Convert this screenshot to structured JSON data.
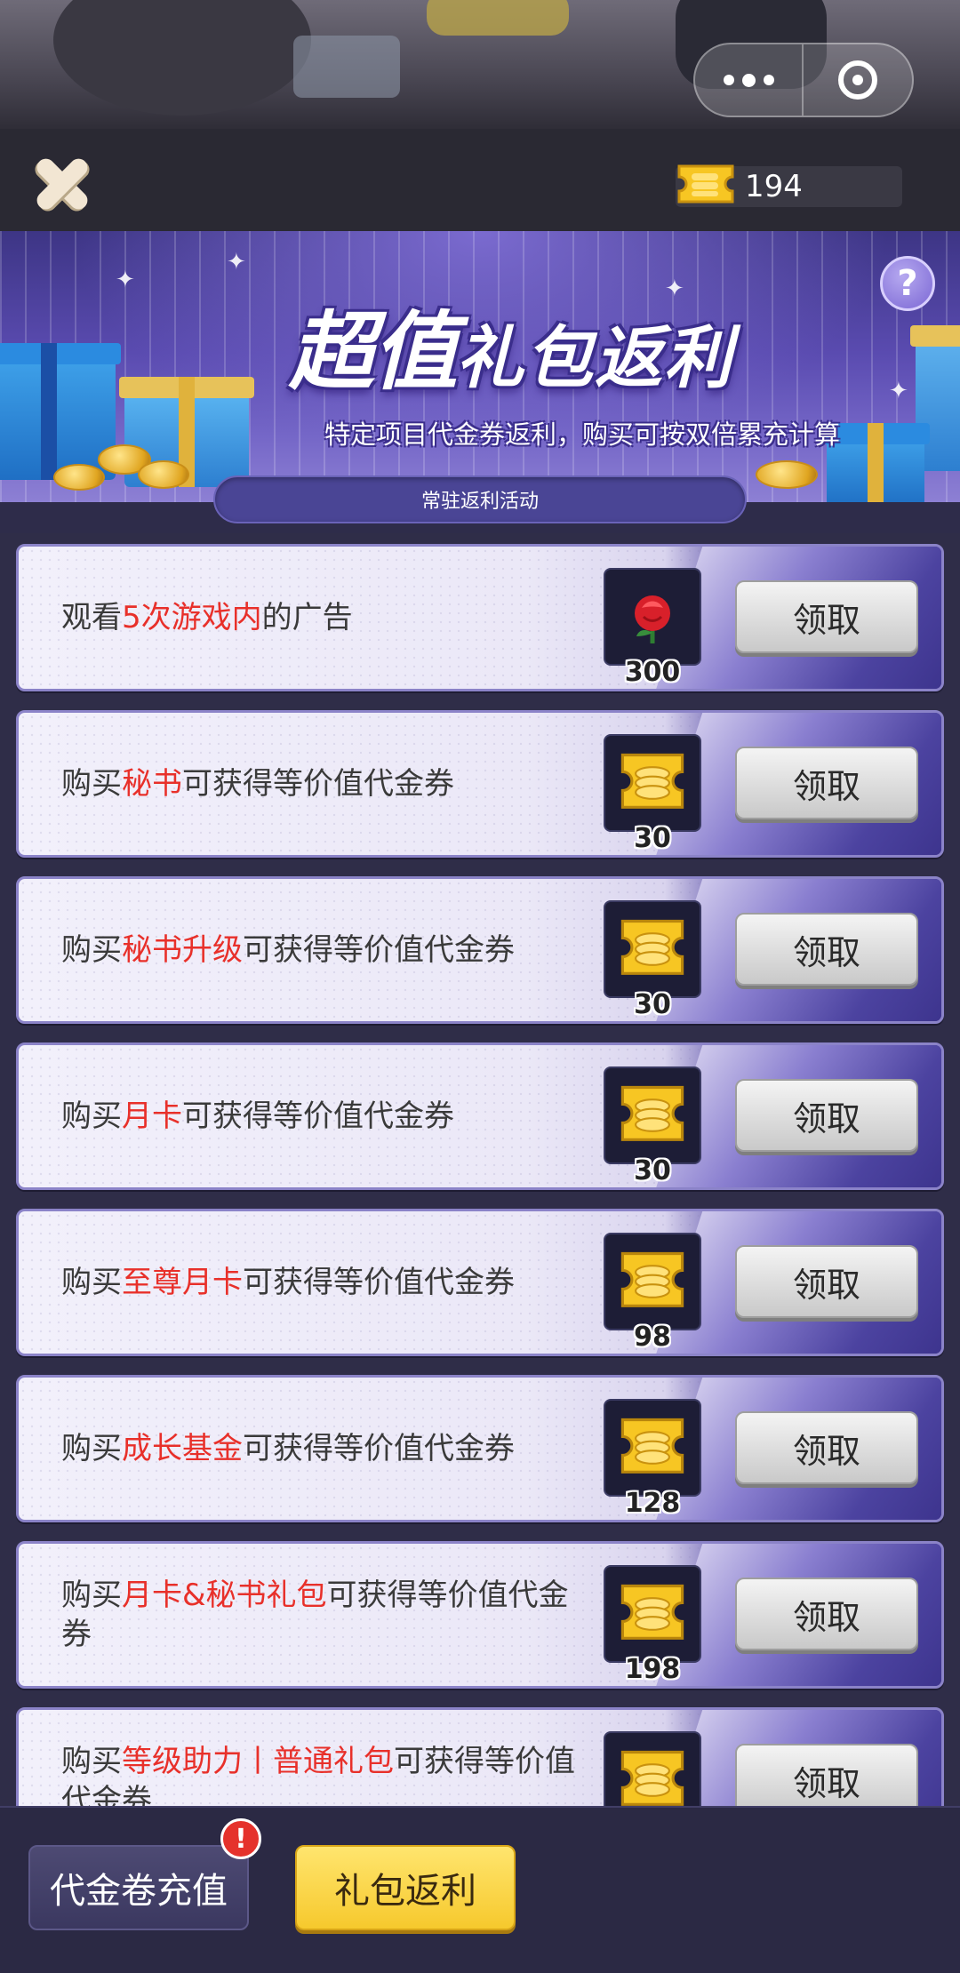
{
  "header": {
    "close_label": "close",
    "voucher_balance": "194"
  },
  "banner": {
    "title_part1": "超值",
    "title_part2": "礼包返利",
    "subtitle": "特定项目代金券返利，购买可按双倍累充计算",
    "help_label": "?",
    "tab_label": "常驻返利活动"
  },
  "tasks": [
    {
      "pre": "观看",
      "hl": "5次游戏内",
      "post": "的广告",
      "reward_icon": "rose-icon",
      "quantity": "300",
      "button": "领取"
    },
    {
      "pre": "购买",
      "hl": "秘书",
      "post": "可获得等价值代金券",
      "reward_icon": "voucher-icon",
      "quantity": "30",
      "button": "领取"
    },
    {
      "pre": "购买",
      "hl": "秘书升级",
      "post": "可获得等价值代金券",
      "reward_icon": "voucher-icon",
      "quantity": "30",
      "button": "领取"
    },
    {
      "pre": "购买",
      "hl": "月卡",
      "post": "可获得等价值代金券",
      "reward_icon": "voucher-icon",
      "quantity": "30",
      "button": "领取"
    },
    {
      "pre": "购买",
      "hl": "至尊月卡",
      "post": "可获得等价值代金券",
      "reward_icon": "voucher-icon",
      "quantity": "98",
      "button": "领取"
    },
    {
      "pre": "购买",
      "hl": "成长基金",
      "post": "可获得等价值代金券",
      "reward_icon": "voucher-icon",
      "quantity": "128",
      "button": "领取"
    },
    {
      "pre": "购买",
      "hl": "月卡&秘书礼包",
      "post": "可获得等价值代金券",
      "reward_icon": "voucher-icon",
      "quantity": "198",
      "button": "领取"
    },
    {
      "pre": "购买",
      "hl": "等级助力丨普通礼包",
      "post": "可获得等价值代金券",
      "reward_icon": "voucher-icon",
      "quantity": "",
      "button": "领取"
    }
  ],
  "bottom_nav": {
    "voucher_recharge": "代金卷充值",
    "gift_rebate": "礼包返利",
    "alert_badge": "!"
  },
  "colors": {
    "highlight": "#e8302a",
    "accent_gold": "#f6c92d",
    "banner_purple": "#5a4bb0"
  }
}
